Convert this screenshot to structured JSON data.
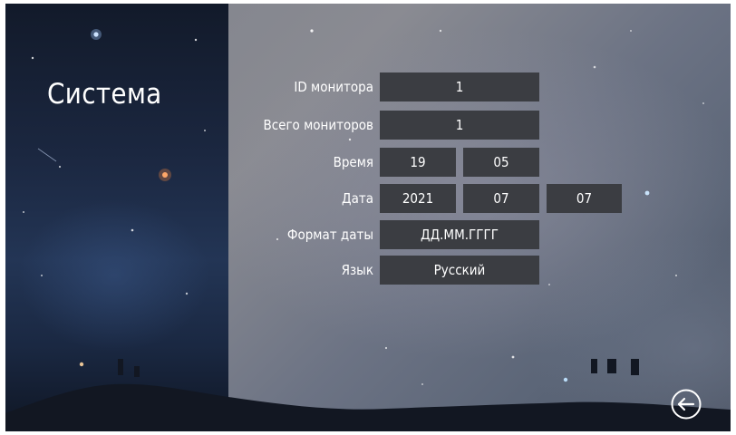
{
  "page": {
    "title": "Система"
  },
  "rows": {
    "monitor_id": {
      "label": "ID монитора",
      "value": "1"
    },
    "total_monitors": {
      "label": "Всего мониторов",
      "value": "1"
    },
    "time": {
      "label": "Время",
      "hour": "19",
      "minute": "05"
    },
    "date": {
      "label": "Дата",
      "year": "2021",
      "month": "07",
      "day": "07"
    },
    "date_format": {
      "label": "Формат даты",
      "value": "ДД.ММ.ГГГГ"
    },
    "language": {
      "label": "Язык",
      "value": "Русский"
    }
  },
  "icons": {
    "back": "back-arrow-icon"
  }
}
